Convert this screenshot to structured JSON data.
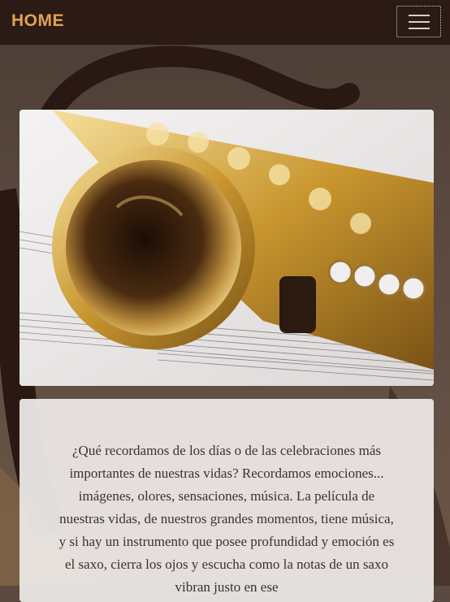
{
  "navbar": {
    "brand": "HOME",
    "toggler_icon": "hamburger-menu-icon"
  },
  "hero": {
    "image_icon": "saxophone-photo"
  },
  "intro": {
    "text": "¿Qué recordamos de los días o de las celebraciones más importantes de nuestras vidas? Recordamos emociones... imágenes, olores, sensaciones, música. La película de nuestras vidas, de nuestros grandes momentos, tiene música, y si hay un instrumento que posee profundidad y emoción es el saxo, cierra los ojos y escucha como la notas de un saxo vibran justo en ese"
  },
  "colors": {
    "navbar_bg": "#2c1a14",
    "brand": "#e3a24f",
    "page_bg": "#5a4a41"
  }
}
